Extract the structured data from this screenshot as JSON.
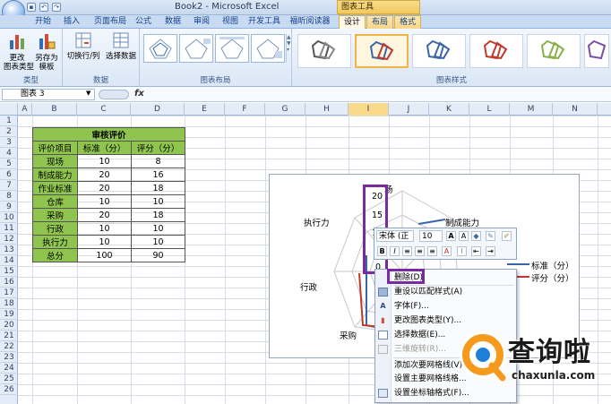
{
  "window": {
    "title": "Book2 - Microsoft Excel",
    "context_tools": "图表工具"
  },
  "tabs": [
    {
      "label": "开始"
    },
    {
      "label": "插入"
    },
    {
      "label": "页面布局"
    },
    {
      "label": "公式"
    },
    {
      "label": "数据"
    },
    {
      "label": "审阅"
    },
    {
      "label": "视图"
    },
    {
      "label": "开发工具"
    },
    {
      "label": "福昕阅读器"
    },
    {
      "label": "设计"
    },
    {
      "label": "布局"
    },
    {
      "label": "格式"
    }
  ],
  "ribbon": {
    "change_type": "更改\n图表类型",
    "save_template": "另存为\n模板",
    "group_type": "类型",
    "switch_rowcol": "切换行/列",
    "select_data": "选择数据",
    "group_data": "数据",
    "group_layout": "图表布局",
    "group_styles": "图表样式"
  },
  "formula_bar": {
    "name_box": "图表 3",
    "fx": "fx"
  },
  "columns": [
    "A",
    "B",
    "C",
    "D",
    "E",
    "F",
    "G",
    "H",
    "I",
    "J",
    "K",
    "L",
    "M",
    "N"
  ],
  "rows": [
    "1",
    "2",
    "3",
    "4",
    "5",
    "6",
    "7",
    "8",
    "9",
    "10",
    "11",
    "12",
    "13",
    "14",
    "15",
    "16",
    "17",
    "18",
    "19",
    "20",
    "21",
    "22",
    "23",
    "24",
    "25",
    "26"
  ],
  "table": {
    "title": "审核评价",
    "headers": [
      "评价项目",
      "标准（分）",
      "评分（分）"
    ],
    "rows": [
      [
        "现场",
        "10",
        "8"
      ],
      [
        "制成能力",
        "20",
        "16"
      ],
      [
        "作业标准",
        "20",
        "18"
      ],
      [
        "仓库",
        "10",
        "10"
      ],
      [
        "采购",
        "20",
        "18"
      ],
      [
        "行政",
        "10",
        "10"
      ],
      [
        "执行力",
        "10",
        "10"
      ],
      [
        "总分",
        "100",
        "90"
      ]
    ]
  },
  "chart": {
    "axis_ticks": [
      "20",
      "15",
      "1",
      "0"
    ],
    "labels": {
      "top": "场",
      "right": "制成能力",
      "left": "执行力",
      "left2": "行政",
      "bottom": "采购"
    },
    "legend": [
      "标准（分）",
      "评分（分）"
    ]
  },
  "minibar": {
    "font": "宋体 (正文",
    "size": "10"
  },
  "context_menu": [
    {
      "label": "删除(D)"
    },
    {
      "label": "重设以匹配样式(A)"
    },
    {
      "label": "字体(F)..."
    },
    {
      "label": "更改图表类型(Y)..."
    },
    {
      "label": "选择数据(E)..."
    },
    {
      "label": "三维旋转(R)..."
    },
    {
      "label": "添加次要网格线(V)"
    },
    {
      "label": "设置主要网格线格..."
    },
    {
      "label": "设置坐标轴格式(F)..."
    }
  ],
  "watermark": {
    "name": "查询啦",
    "url": "chaxunla.com"
  },
  "colors": {
    "accent_purple": "#7a2aa0",
    "table_green": "#8fc54e",
    "series1": "#3b66a6",
    "series2": "#c0392b"
  }
}
